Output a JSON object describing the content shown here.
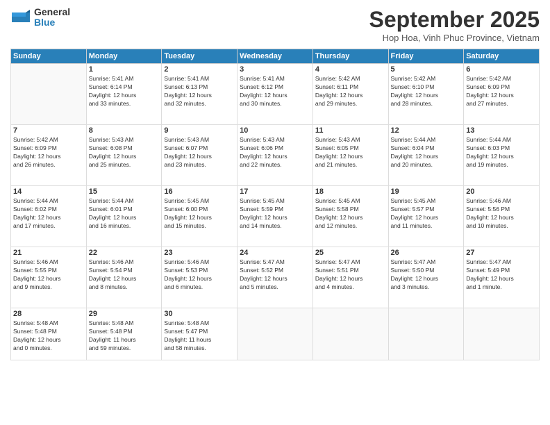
{
  "header": {
    "logo_general": "General",
    "logo_blue": "Blue",
    "month_title": "September 2025",
    "location": "Hop Hoa, Vinh Phuc Province, Vietnam"
  },
  "weekdays": [
    "Sunday",
    "Monday",
    "Tuesday",
    "Wednesday",
    "Thursday",
    "Friday",
    "Saturday"
  ],
  "weeks": [
    [
      {
        "day": "",
        "info": ""
      },
      {
        "day": "1",
        "info": "Sunrise: 5:41 AM\nSunset: 6:14 PM\nDaylight: 12 hours\nand 33 minutes."
      },
      {
        "day": "2",
        "info": "Sunrise: 5:41 AM\nSunset: 6:13 PM\nDaylight: 12 hours\nand 32 minutes."
      },
      {
        "day": "3",
        "info": "Sunrise: 5:41 AM\nSunset: 6:12 PM\nDaylight: 12 hours\nand 30 minutes."
      },
      {
        "day": "4",
        "info": "Sunrise: 5:42 AM\nSunset: 6:11 PM\nDaylight: 12 hours\nand 29 minutes."
      },
      {
        "day": "5",
        "info": "Sunrise: 5:42 AM\nSunset: 6:10 PM\nDaylight: 12 hours\nand 28 minutes."
      },
      {
        "day": "6",
        "info": "Sunrise: 5:42 AM\nSunset: 6:09 PM\nDaylight: 12 hours\nand 27 minutes."
      }
    ],
    [
      {
        "day": "7",
        "info": "Sunrise: 5:42 AM\nSunset: 6:09 PM\nDaylight: 12 hours\nand 26 minutes."
      },
      {
        "day": "8",
        "info": "Sunrise: 5:43 AM\nSunset: 6:08 PM\nDaylight: 12 hours\nand 25 minutes."
      },
      {
        "day": "9",
        "info": "Sunrise: 5:43 AM\nSunset: 6:07 PM\nDaylight: 12 hours\nand 23 minutes."
      },
      {
        "day": "10",
        "info": "Sunrise: 5:43 AM\nSunset: 6:06 PM\nDaylight: 12 hours\nand 22 minutes."
      },
      {
        "day": "11",
        "info": "Sunrise: 5:43 AM\nSunset: 6:05 PM\nDaylight: 12 hours\nand 21 minutes."
      },
      {
        "day": "12",
        "info": "Sunrise: 5:44 AM\nSunset: 6:04 PM\nDaylight: 12 hours\nand 20 minutes."
      },
      {
        "day": "13",
        "info": "Sunrise: 5:44 AM\nSunset: 6:03 PM\nDaylight: 12 hours\nand 19 minutes."
      }
    ],
    [
      {
        "day": "14",
        "info": "Sunrise: 5:44 AM\nSunset: 6:02 PM\nDaylight: 12 hours\nand 17 minutes."
      },
      {
        "day": "15",
        "info": "Sunrise: 5:44 AM\nSunset: 6:01 PM\nDaylight: 12 hours\nand 16 minutes."
      },
      {
        "day": "16",
        "info": "Sunrise: 5:45 AM\nSunset: 6:00 PM\nDaylight: 12 hours\nand 15 minutes."
      },
      {
        "day": "17",
        "info": "Sunrise: 5:45 AM\nSunset: 5:59 PM\nDaylight: 12 hours\nand 14 minutes."
      },
      {
        "day": "18",
        "info": "Sunrise: 5:45 AM\nSunset: 5:58 PM\nDaylight: 12 hours\nand 12 minutes."
      },
      {
        "day": "19",
        "info": "Sunrise: 5:45 AM\nSunset: 5:57 PM\nDaylight: 12 hours\nand 11 minutes."
      },
      {
        "day": "20",
        "info": "Sunrise: 5:46 AM\nSunset: 5:56 PM\nDaylight: 12 hours\nand 10 minutes."
      }
    ],
    [
      {
        "day": "21",
        "info": "Sunrise: 5:46 AM\nSunset: 5:55 PM\nDaylight: 12 hours\nand 9 minutes."
      },
      {
        "day": "22",
        "info": "Sunrise: 5:46 AM\nSunset: 5:54 PM\nDaylight: 12 hours\nand 8 minutes."
      },
      {
        "day": "23",
        "info": "Sunrise: 5:46 AM\nSunset: 5:53 PM\nDaylight: 12 hours\nand 6 minutes."
      },
      {
        "day": "24",
        "info": "Sunrise: 5:47 AM\nSunset: 5:52 PM\nDaylight: 12 hours\nand 5 minutes."
      },
      {
        "day": "25",
        "info": "Sunrise: 5:47 AM\nSunset: 5:51 PM\nDaylight: 12 hours\nand 4 minutes."
      },
      {
        "day": "26",
        "info": "Sunrise: 5:47 AM\nSunset: 5:50 PM\nDaylight: 12 hours\nand 3 minutes."
      },
      {
        "day": "27",
        "info": "Sunrise: 5:47 AM\nSunset: 5:49 PM\nDaylight: 12 hours\nand 1 minute."
      }
    ],
    [
      {
        "day": "28",
        "info": "Sunrise: 5:48 AM\nSunset: 5:48 PM\nDaylight: 12 hours\nand 0 minutes."
      },
      {
        "day": "29",
        "info": "Sunrise: 5:48 AM\nSunset: 5:48 PM\nDaylight: 11 hours\nand 59 minutes."
      },
      {
        "day": "30",
        "info": "Sunrise: 5:48 AM\nSunset: 5:47 PM\nDaylight: 11 hours\nand 58 minutes."
      },
      {
        "day": "",
        "info": ""
      },
      {
        "day": "",
        "info": ""
      },
      {
        "day": "",
        "info": ""
      },
      {
        "day": "",
        "info": ""
      }
    ]
  ]
}
